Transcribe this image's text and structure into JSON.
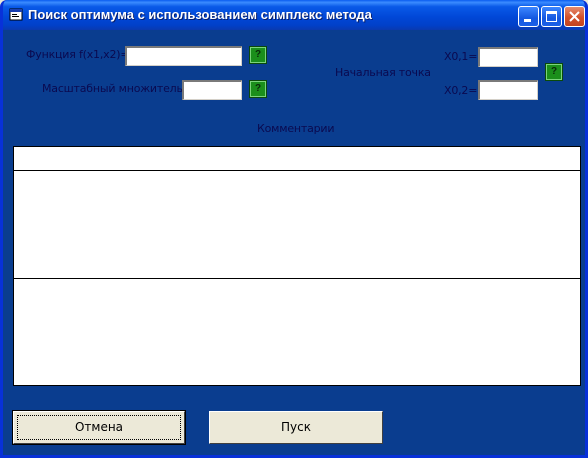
{
  "window": {
    "title": "Поиск оптимума с использованием симплекс метода"
  },
  "form": {
    "function_label": "Функция f(x1,x2)=",
    "function_value": "",
    "scale_label": "Масштабный множитель=",
    "scale_value": "",
    "start_point_label": "Начальная точка",
    "x01_label": "X0,1=",
    "x01_value": "",
    "x02_label": "X0,2=",
    "x02_value": "",
    "help_glyph": "?"
  },
  "comments": {
    "label": "Комментарии"
  },
  "buttons": {
    "cancel_label": "Отмена",
    "run_label": "Пуск"
  },
  "icons": {
    "help": "help-icon",
    "app": "app-icon",
    "minimize": "minimize-icon",
    "maximize": "maximize-icon",
    "close": "close-icon"
  },
  "colors": {
    "client_background": "#0a3d8f",
    "help_button": "#1b8f1b"
  }
}
